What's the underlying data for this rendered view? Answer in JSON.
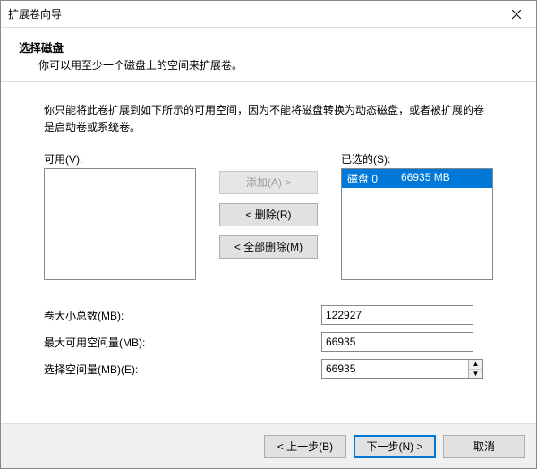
{
  "window": {
    "title": "扩展卷向导"
  },
  "header": {
    "title": "选择磁盘",
    "subtitle": "你可以用至少一个磁盘上的空间来扩展卷。"
  },
  "hint": "你只能将此卷扩展到如下所示的可用空间，因为不能将磁盘转换为动态磁盘，或者被扩展的卷是启动卷或系统卷。",
  "labels": {
    "available": "可用(V):",
    "selected": "已选的(S):",
    "add": "添加(A) >",
    "remove": "< 删除(R)",
    "removeAll": "< 全部删除(M)",
    "totalSize": "卷大小总数(MB):",
    "maxAvail": "最大可用空间量(MB):",
    "selectAmount": "选择空间量(MB)(E):",
    "back": "< 上一步(B)",
    "next": "下一步(N) >",
    "cancel": "取消"
  },
  "selectedList": {
    "items": [
      {
        "disk": "磁盘 0",
        "size": "66935 MB",
        "selected": true
      }
    ]
  },
  "values": {
    "totalSize": "122927",
    "maxAvail": "66935",
    "selectAmount": "66935"
  }
}
